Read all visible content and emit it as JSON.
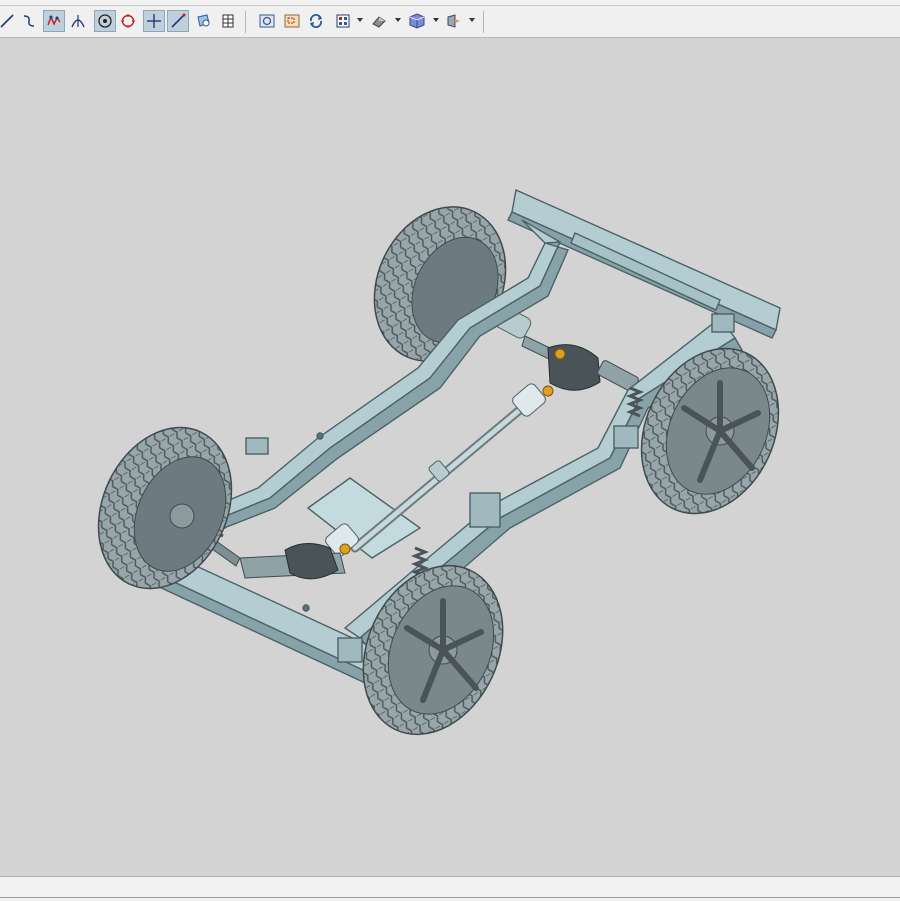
{
  "menu": {
    "items": [
      "",
      "",
      "",
      "",
      "",
      "",
      ""
    ]
  },
  "toolbar": {
    "tools": [
      {
        "icon": "line-icon"
      },
      {
        "icon": "curve-icon"
      },
      {
        "icon": "snap-curve-icon",
        "active": true
      },
      {
        "icon": "intersection-icon"
      },
      {
        "icon": "point-on-face-icon",
        "active": true
      },
      {
        "icon": "circle-center-icon"
      },
      {
        "icon": "crosshair-icon",
        "active": true
      },
      {
        "icon": "slash-line-icon",
        "active": true
      },
      {
        "icon": "face-select-icon"
      },
      {
        "icon": "grid-table-icon"
      },
      {
        "icon": "fit-view-icon"
      },
      {
        "icon": "zoom-region-icon"
      },
      {
        "icon": "rotate-icon"
      },
      {
        "icon": "orient-view-icon"
      },
      {
        "icon": "render-style-icon"
      },
      {
        "icon": "cube-view-icon"
      },
      {
        "icon": "section-view-icon"
      }
    ]
  },
  "viewport": {
    "background": "#d3d3d3",
    "model": "vehicle-chassis-model"
  },
  "colors": {
    "frame": "#b3cdd2",
    "frame_dark": "#7f9ea4",
    "tire": "#8c9a9e",
    "rim": "#6d7b80",
    "accent": "#e0a020"
  }
}
